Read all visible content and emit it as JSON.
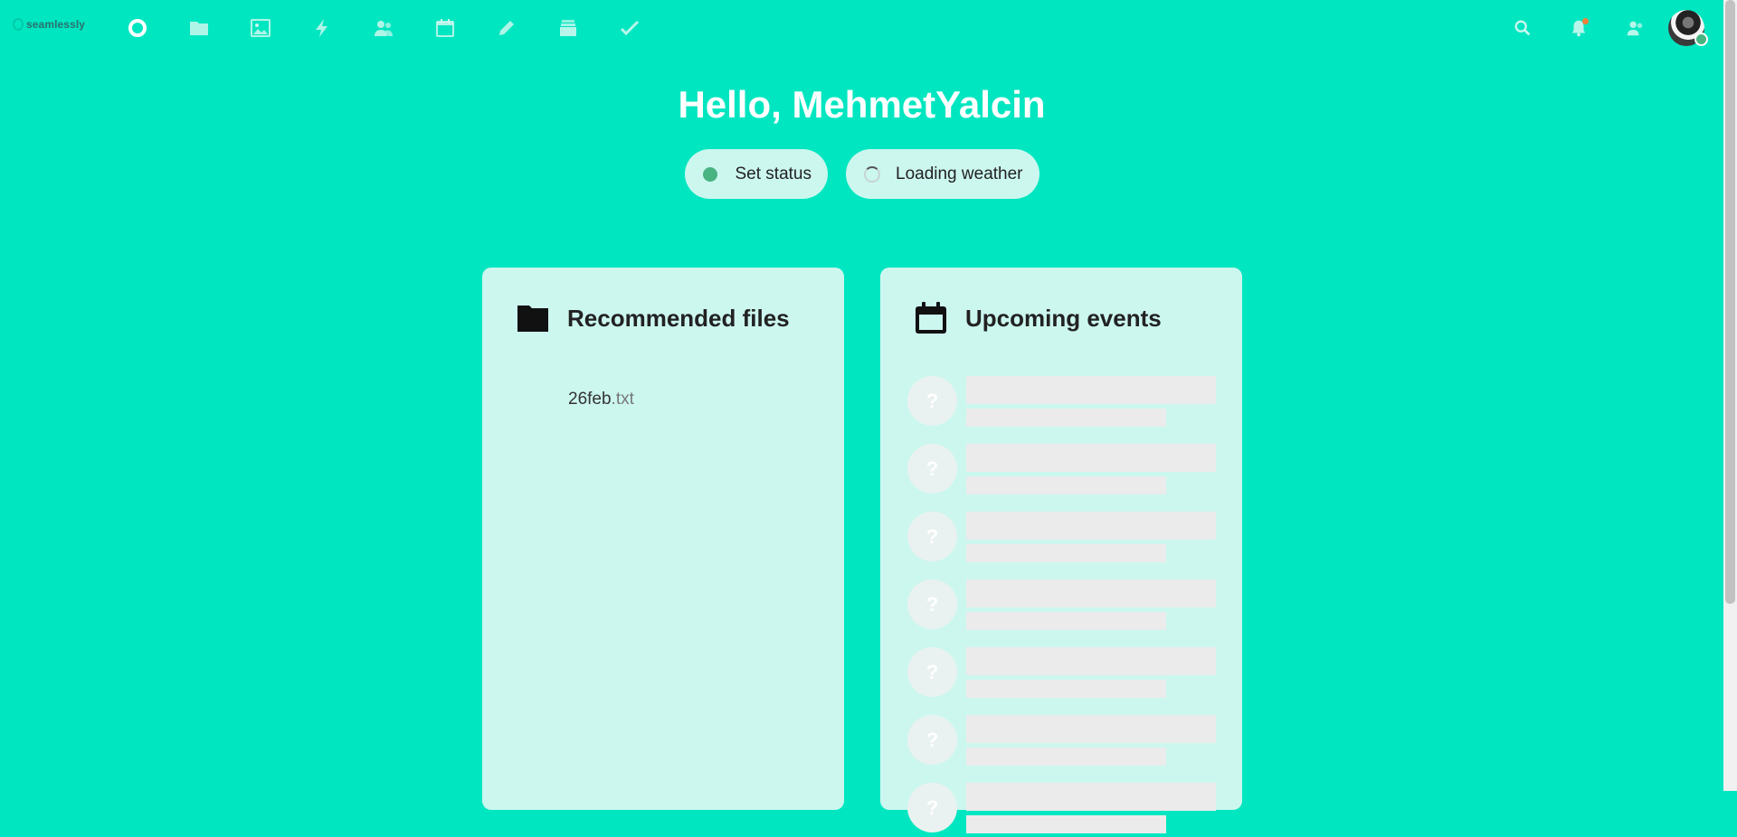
{
  "header": {
    "logo_text": "seamlessly",
    "apps": [
      {
        "name": "dashboard-icon"
      },
      {
        "name": "files-icon"
      },
      {
        "name": "photos-icon"
      },
      {
        "name": "activity-icon"
      },
      {
        "name": "contacts-icon"
      },
      {
        "name": "calendar-icon"
      },
      {
        "name": "notes-icon"
      },
      {
        "name": "deck-icon"
      },
      {
        "name": "tasks-icon"
      }
    ],
    "right_icons": [
      "search-icon",
      "notifications-icon",
      "contacts-menu-icon"
    ],
    "user_status_color": "#49b382"
  },
  "greeting": "Hello, MehmetYalcin",
  "status_button": {
    "label": "Set status",
    "color": "#49b382"
  },
  "weather_button": {
    "label": "Loading weather"
  },
  "panels": {
    "files": {
      "title": "Recommended files",
      "items": [
        {
          "name": "26feb",
          "ext": ".txt"
        }
      ]
    },
    "events": {
      "title": "Upcoming events",
      "placeholder_avatar": "?",
      "loading_rows": 7
    }
  },
  "colors": {
    "background": "#00e6c0",
    "panel": "#ccf7ef",
    "skeleton": "#ebebeb"
  }
}
